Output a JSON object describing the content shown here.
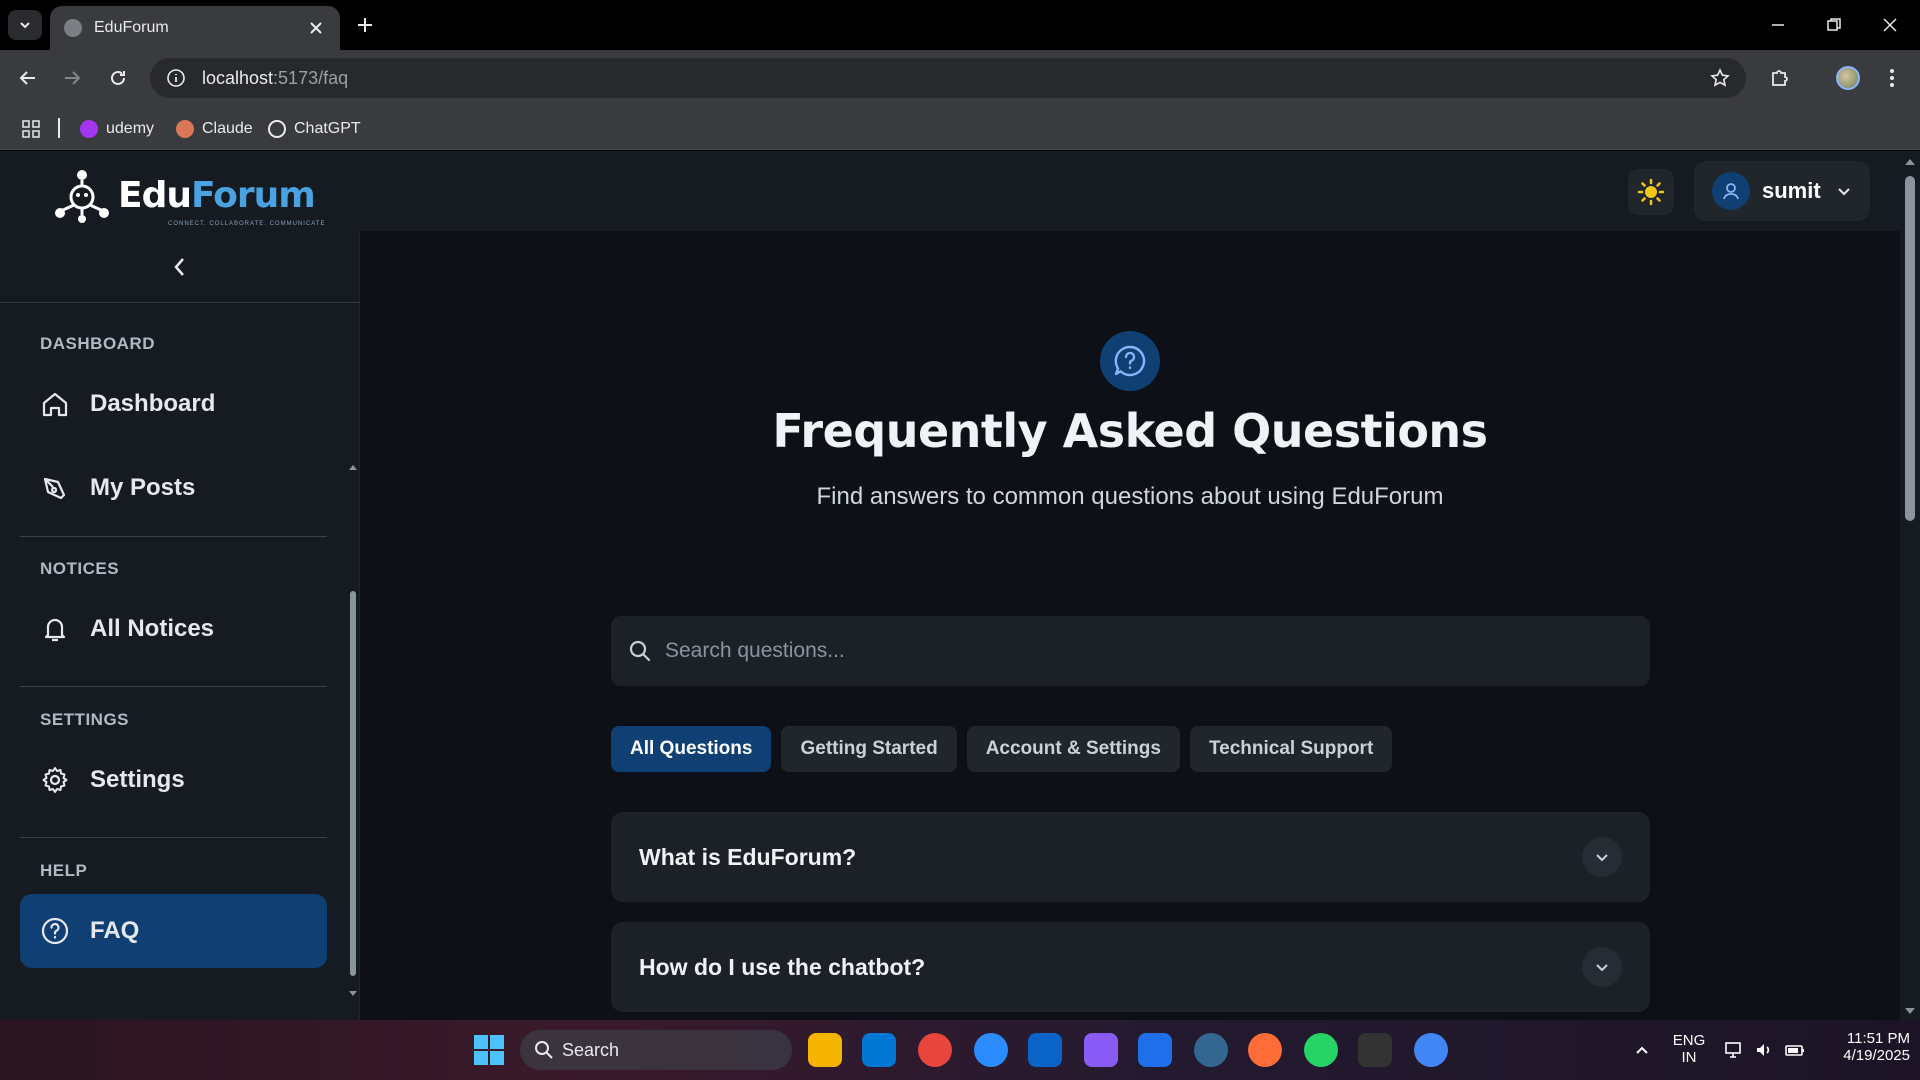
{
  "browser": {
    "tab_title": "EduForum",
    "url_host": "localhost",
    "url_path": ":5173/faq",
    "bookmarks": [
      "udemy",
      "Claude",
      "ChatGPT"
    ]
  },
  "header": {
    "logo_edu": "Edu",
    "logo_forum": "Forum",
    "logo_tagline": "CONNECT. COLLABORATE. COMMUNICATE",
    "user_name": "sumit"
  },
  "sidebar": {
    "sections": [
      {
        "label": "DASHBOARD",
        "items": [
          "Dashboard",
          "My Posts"
        ]
      },
      {
        "label": "NOTICES",
        "items": [
          "All Notices"
        ]
      },
      {
        "label": "SETTINGS",
        "items": [
          "Settings"
        ]
      },
      {
        "label": "HELP",
        "items": [
          "FAQ"
        ]
      }
    ],
    "active_item": "FAQ"
  },
  "main": {
    "title": "Frequently Asked Questions",
    "subtitle": "Find answers to common questions about using EduForum",
    "search_placeholder": "Search questions...",
    "filters": [
      "All Questions",
      "Getting Started",
      "Account & Settings",
      "Technical Support"
    ],
    "active_filter": "All Questions",
    "questions": [
      "What is EduForum?",
      "How do I use the chatbot?"
    ]
  },
  "taskbar": {
    "search_label": "Search",
    "language": "ENG",
    "region": "IN",
    "time": "11:51 PM",
    "date": "4/19/2025"
  },
  "colors": {
    "accent": "#0f3f73",
    "logo_forum": "#4aa3e0",
    "theme_icon": "#f5c518"
  },
  "icons": [
    "home-icon",
    "pen-icon",
    "bell-icon",
    "gear-icon",
    "help-circle-icon",
    "search-icon",
    "sun-icon",
    "user-icon",
    "chevron-down-icon",
    "chevron-left-icon"
  ]
}
